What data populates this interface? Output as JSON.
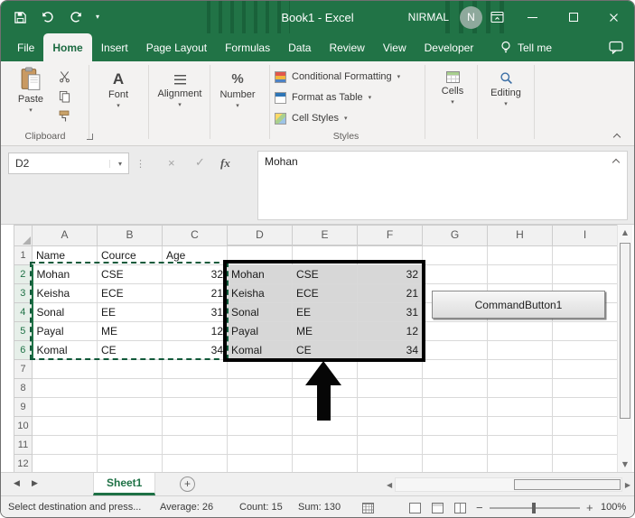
{
  "window": {
    "title": "Book1 - Excel",
    "user_name": "NIRMAL",
    "user_initial": "N"
  },
  "tabs": {
    "items": [
      {
        "label": "File",
        "active": false
      },
      {
        "label": "Home",
        "active": true
      },
      {
        "label": "Insert",
        "active": false
      },
      {
        "label": "Page Layout",
        "active": false
      },
      {
        "label": "Formulas",
        "active": false
      },
      {
        "label": "Data",
        "active": false
      },
      {
        "label": "Review",
        "active": false
      },
      {
        "label": "View",
        "active": false
      },
      {
        "label": "Developer",
        "active": false
      }
    ],
    "tell_me": "Tell me"
  },
  "ribbon": {
    "paste_label": "Paste",
    "font_label": "Font",
    "alignment_label": "Alignment",
    "number_label": "Number",
    "styles_buttons": [
      "Conditional Formatting",
      "Format as Table",
      "Cell Styles"
    ],
    "cells_label": "Cells",
    "editing_label": "Editing",
    "group_clipboard": "Clipboard",
    "group_styles": "Styles"
  },
  "formula_bar": {
    "name_box": "D2",
    "content": "Mohan"
  },
  "sheet": {
    "columns": [
      "A",
      "B",
      "C",
      "D",
      "E",
      "F",
      "G",
      "H",
      "I"
    ],
    "rows": [
      "1",
      "2",
      "3",
      "4",
      "5",
      "6",
      "7",
      "8",
      "9",
      "10",
      "11",
      "12"
    ],
    "selected_columns": [
      "D",
      "E",
      "F"
    ],
    "selected_rows": [
      "2",
      "3",
      "4",
      "5",
      "6"
    ],
    "header_cells": [
      {
        "col": "A",
        "row": "1",
        "value": "Name"
      },
      {
        "col": "B",
        "row": "1",
        "value": "Cource"
      },
      {
        "col": "C",
        "row": "1",
        "value": "Age"
      }
    ],
    "source_block": {
      "cols": [
        "A",
        "B",
        "C"
      ],
      "first_row": 2,
      "rows": [
        [
          "Mohan",
          "CSE",
          "32"
        ],
        [
          "Keisha",
          "ECE",
          "21"
        ],
        [
          "Sonal",
          "EE",
          "31"
        ],
        [
          "Payal",
          "ME",
          "12"
        ],
        [
          "Komal",
          "CE",
          "34"
        ]
      ]
    },
    "dest_block": {
      "cols": [
        "D",
        "E",
        "F"
      ],
      "first_row": 2,
      "rows": [
        [
          "Mohan",
          "CSE",
          "32"
        ],
        [
          "Keisha",
          "ECE",
          "21"
        ],
        [
          "Sonal",
          "EE",
          "31"
        ],
        [
          "Payal",
          "ME",
          "12"
        ],
        [
          "Komal",
          "CE",
          "34"
        ]
      ]
    },
    "command_button_label": "CommandButton1"
  },
  "sheet_tabs": {
    "active": "Sheet1"
  },
  "status_bar": {
    "mode_text": "Select destination and press...",
    "average": "Average: 26",
    "count": "Count: 15",
    "sum": "Sum: 130",
    "zoom": "100%"
  },
  "icons": {
    "caret_down": "▾",
    "ellipsis_v": "⋮",
    "cancel": "×",
    "check": "✓",
    "fx": "fx",
    "up_arrow": "▲",
    "down_arrow": "▼",
    "left_arrow": "◀",
    "right_arrow": "▶",
    "plus": "+",
    "minus": "−",
    "percent": "%",
    "font_letter": "A"
  },
  "colors": {
    "excel_green": "#217346",
    "header_select_green": "#1e7145",
    "selection_fill": "#d7d7d7",
    "marching_ants_green": "#11593a"
  }
}
